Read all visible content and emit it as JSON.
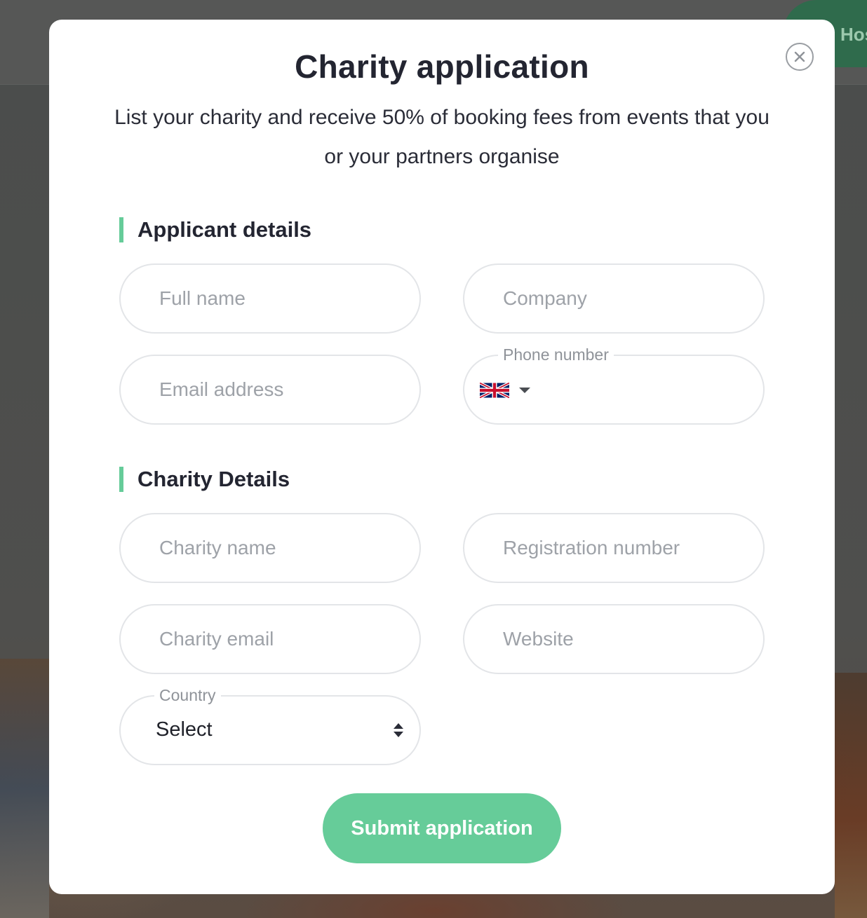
{
  "background": {
    "host_button_label": "Host"
  },
  "modal": {
    "title": "Charity application",
    "subtitle": "List your charity and receive 50% of booking fees from events that you or your partners organise",
    "close_icon": "close-icon"
  },
  "applicant_section": {
    "heading": "Applicant details",
    "full_name_placeholder": "Full name",
    "company_placeholder": "Company",
    "email_placeholder": "Email address",
    "phone_label": "Phone number",
    "phone_flag": "uk-flag-icon",
    "phone_value": ""
  },
  "charity_section": {
    "heading": "Charity Details",
    "charity_name_placeholder": "Charity name",
    "registration_placeholder": "Registration number",
    "charity_email_placeholder": "Charity email",
    "website_placeholder": "Website",
    "country_label": "Country",
    "country_selected": "Select"
  },
  "actions": {
    "submit_label": "Submit application"
  },
  "colors": {
    "accent": "#66cc99",
    "text": "#232531",
    "placeholder": "#9ea2a8",
    "field_border": "#e3e5e8"
  }
}
